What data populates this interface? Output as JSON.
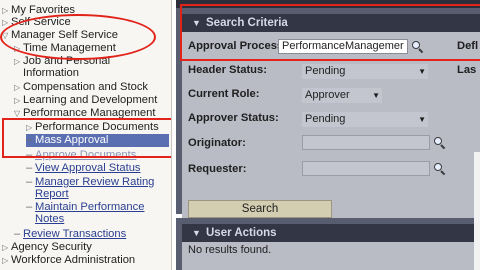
{
  "menu": {
    "my_favorites": "My Favorites",
    "self_service": "Self Service",
    "manager_self_service": "Manager Self Service",
    "time_management": "Time Management",
    "job_personal_1": "Job and Personal",
    "job_personal_2": "Information",
    "comp_stock": "Compensation and Stock",
    "learning": "Learning and Development",
    "perf_mgmt": "Performance Management",
    "perf_docs": "Performance Documents",
    "mass_approval": "Mass Approval",
    "approve_docs": "Approve Documents",
    "view_approval": "View Approval Status",
    "mgr_review_1": "Manager Review Rating",
    "mgr_review_2": "Report",
    "maint_perf_1": "Maintain Performance",
    "maint_perf_2": "Notes",
    "review_tx": "Review Transactions",
    "agency_security": "Agency Security",
    "workforce_admin": "Workforce Administration"
  },
  "search_criteria": {
    "title": "Search Criteria",
    "approval_process_label": "Approval Process:",
    "approval_process_value": "PerformanceManagemer",
    "defl_label": "Defl",
    "header_status_label": "Header Status:",
    "header_status_value": "Pending",
    "las_label": "Las",
    "current_role_label": "Current Role:",
    "current_role_value": "Approver",
    "approver_status_label": "Approver Status:",
    "approver_status_value": "Pending",
    "originator_label": "Originator:",
    "requester_label": "Requester:",
    "search_button": "Search"
  },
  "user_actions": {
    "title": "User Actions",
    "no_results": "No results found."
  },
  "colors": {
    "annotation_red": "#e2231a",
    "selected_item": "#5a6fb1",
    "panel_header": "#323645",
    "panel_body": "#b9bbc5"
  }
}
